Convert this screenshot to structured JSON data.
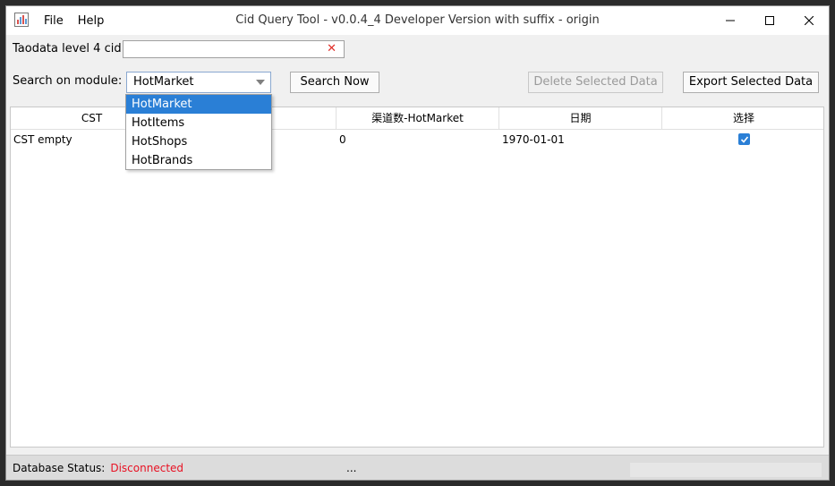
{
  "window": {
    "title": "Cid Query Tool - v0.0.4_4 Developer Version with suffix - origin",
    "menu": [
      "File",
      "Help"
    ],
    "controls": {
      "minimize": "minimize-icon",
      "maximize": "maximize-icon",
      "close": "close-icon"
    }
  },
  "form": {
    "cid_label": "Taodata level 4 cid:",
    "cid_value": "",
    "clear_icon": "✕",
    "module_label": "Search on module:",
    "module_selected": "HotMarket",
    "module_options": [
      "HotMarket",
      "HotItems",
      "HotShops",
      "HotBrands"
    ]
  },
  "buttons": {
    "search": "Search Now",
    "delete": "Delete Selected Data",
    "export": "Export Selected Data"
  },
  "table": {
    "columns": [
      "CST",
      "",
      "渠道数-HotMarket",
      "日期",
      "选择"
    ],
    "rows": [
      {
        "cst": "CST empty",
        "col2": "",
        "channels": "0",
        "date": "1970-01-01",
        "selected": true
      }
    ]
  },
  "status": {
    "label": "Database Status:",
    "value": "Disconnected",
    "extra": "..."
  },
  "colors": {
    "accent": "#2a7fd6",
    "error": "#e81123",
    "clear_icon": "#e0302a"
  }
}
